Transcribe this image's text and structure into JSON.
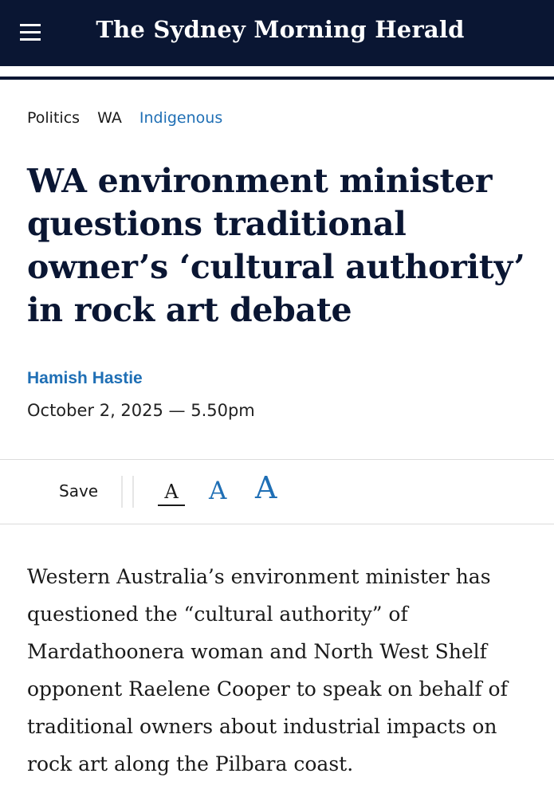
{
  "header": {
    "menu_icon": "hamburger-menu-icon",
    "masthead": "The Sydney Morning Herald",
    "background": "#0a1633"
  },
  "breadcrumbs": [
    "Politics",
    "WA",
    "Indigenous"
  ],
  "article": {
    "headline": "WA environment minister questions traditional owner’s ‘cultural authority’ in rock art debate",
    "author": "Hamish Hastie",
    "date": "October 2, 2025 — 5.50pm",
    "body": "Western Australia’s environment minister has questioned the “cultural authority” of Mardathoonera woman and North West Shelf opponent Raelene Cooper to speak on behalf of traditional owners about industrial impacts on rock art along the Pilbara coast."
  },
  "toolbar": {
    "save_label": "Save",
    "font_size_small": "A",
    "font_size_medium": "A",
    "font_size_large": "A"
  },
  "colors": {
    "accent": "#1f6fb5",
    "headline": "#0a1633"
  }
}
